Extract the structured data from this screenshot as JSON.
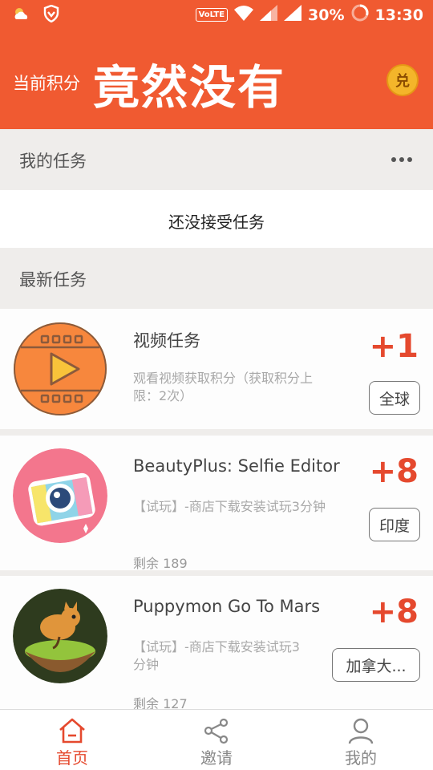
{
  "status_bar": {
    "network": "VoLTE",
    "battery": "30%",
    "time": "13:30",
    "icons": [
      "weather-icon",
      "vpn-shield-icon",
      "wifi-icon",
      "signal-icon",
      "battery-ring-icon"
    ]
  },
  "header": {
    "points_label": "当前积分",
    "points_value": "竟然没有",
    "redeem_icon_label": "兑"
  },
  "my_tasks": {
    "title": "我的任务",
    "empty_text": "还没接受任务"
  },
  "latest_tasks": {
    "title": "最新任务",
    "items": [
      {
        "name": "视频任务",
        "description": "观看视频获取积分（获取积分上限：2次）",
        "reward": "+1",
        "region": "全球",
        "remaining": "",
        "icon": "video-play-icon"
      },
      {
        "name": "BeautyPlus: Selfie Editor",
        "description": "【试玩】-商店下载安装试玩3分钟",
        "reward": "+8",
        "region": "印度",
        "remaining": "剩余 189",
        "icon": "beautyplus-camera-icon"
      },
      {
        "name": "Puppymon Go To Mars",
        "description": "【试玩】-商店下载安装试玩3分钟",
        "reward": "+8",
        "region": "加拿大...",
        "remaining": "剩余 127",
        "icon": "puppymon-game-icon"
      }
    ]
  },
  "tab_bar": {
    "tabs": [
      {
        "label": "首页",
        "icon": "home-icon",
        "active": true
      },
      {
        "label": "邀请",
        "icon": "share-icon",
        "active": false
      },
      {
        "label": "我的",
        "icon": "user-icon",
        "active": false
      }
    ]
  },
  "colors": {
    "brand": "#f05a31",
    "accent": "#e5492e",
    "background": "#efedeb"
  }
}
